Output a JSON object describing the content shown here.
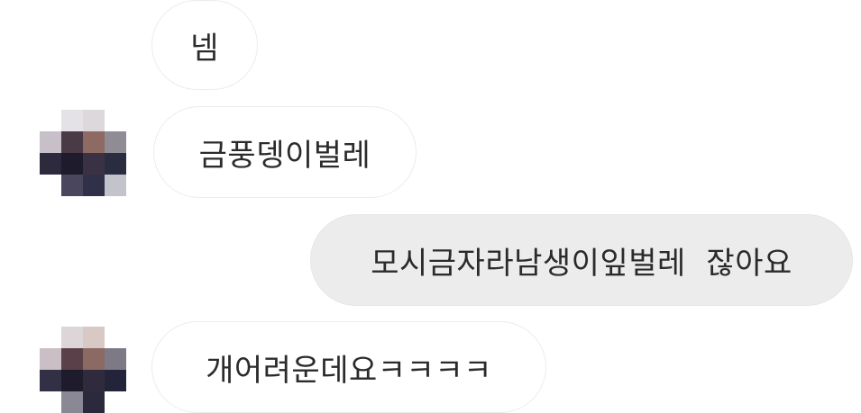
{
  "messages": [
    {
      "id": "m1",
      "direction": "incoming",
      "text": "넴"
    },
    {
      "id": "m2",
      "direction": "incoming",
      "text": "금풍뎅이벌레"
    },
    {
      "id": "m3",
      "direction": "outgoing",
      "text": "모시금자라남생이잎벌레  잖아요"
    },
    {
      "id": "m4",
      "direction": "incoming",
      "text": "개어려운데요ㅋㅋㅋㅋ"
    }
  ],
  "avatars": [
    {
      "name": "sender-avatar",
      "style": "pixelated",
      "pixels": [
        "#ffffff",
        "#e4e2e6",
        "#dcd8db",
        "#ffffff",
        "#c8c0c8",
        "#4a3a46",
        "#8d6a62",
        "#8f8c96",
        "#2e2a3d",
        "#1d1b2c",
        "#3b3145",
        "#2a2c40",
        "#ffffff",
        "#4a465e",
        "#30304a",
        "#c3c3cc"
      ]
    },
    {
      "name": "sender-avatar",
      "style": "pixelated",
      "pixels": [
        "#ffffff",
        "#dcd6d8",
        "#d9c9c6",
        "#ffffff",
        "#c9bfc4",
        "#5a4048",
        "#8a6a62",
        "#7d7a86",
        "#313045",
        "#1e1c2c",
        "#2f2a3c",
        "#23243a",
        "#ffffff",
        "#8b8896",
        "#2a2a3c",
        "#ffffff"
      ]
    }
  ],
  "colors": {
    "incoming_bubble": "#ffffff",
    "outgoing_bubble": "#ececec",
    "text": "#2b2b2b"
  }
}
